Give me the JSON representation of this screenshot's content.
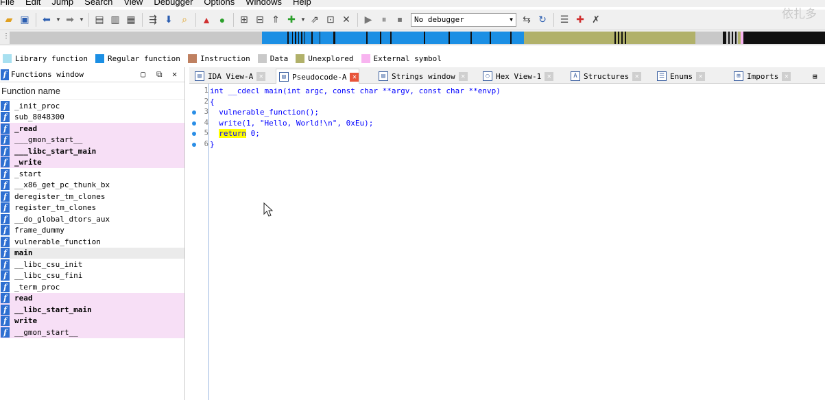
{
  "menu": [
    "File",
    "Edit",
    "Jump",
    "Search",
    "View",
    "Debugger",
    "Options",
    "Windows",
    "Help"
  ],
  "toolbar": {
    "debugger_label": "No debugger"
  },
  "legend": [
    {
      "label": "Library function",
      "color": "#a8e0f0"
    },
    {
      "label": "Regular function",
      "color": "#1b8fe4"
    },
    {
      "label": "Instruction",
      "color": "#bf8060"
    },
    {
      "label": "Data",
      "color": "#c9c9c9"
    },
    {
      "label": "Unexplored",
      "color": "#b1b16a"
    },
    {
      "label": "External symbol",
      "color": "#f8b4f0"
    }
  ],
  "functions_window": {
    "title": "Functions window",
    "column_header": "Function name",
    "items": [
      {
        "name": "_init_proc",
        "style": "normal"
      },
      {
        "name": "sub_8048300",
        "style": "normal"
      },
      {
        "name": "_read",
        "style": "ext"
      },
      {
        "name": "___gmon_start__",
        "style": "ext-normal"
      },
      {
        "name": "___libc_start_main",
        "style": "ext"
      },
      {
        "name": "_write",
        "style": "ext"
      },
      {
        "name": "_start",
        "style": "normal"
      },
      {
        "name": "__x86_get_pc_thunk_bx",
        "style": "normal"
      },
      {
        "name": "deregister_tm_clones",
        "style": "normal"
      },
      {
        "name": "register_tm_clones",
        "style": "normal"
      },
      {
        "name": "__do_global_dtors_aux",
        "style": "normal"
      },
      {
        "name": "frame_dummy",
        "style": "normal"
      },
      {
        "name": "vulnerable_function",
        "style": "normal"
      },
      {
        "name": "main",
        "style": "sel"
      },
      {
        "name": "__libc_csu_init",
        "style": "normal"
      },
      {
        "name": "__libc_csu_fini",
        "style": "normal"
      },
      {
        "name": "_term_proc",
        "style": "normal"
      },
      {
        "name": "read",
        "style": "ext"
      },
      {
        "name": "__libc_start_main",
        "style": "ext"
      },
      {
        "name": "write",
        "style": "ext"
      },
      {
        "name": "__gmon_start__",
        "style": "ext-normal"
      }
    ]
  },
  "tabs": [
    {
      "label": "IDA View-A",
      "active": false
    },
    {
      "label": "Pseudocode-A",
      "active": true
    },
    {
      "label": "Strings window",
      "active": false
    },
    {
      "label": "Hex View-1",
      "active": false
    },
    {
      "label": "Structures",
      "active": false
    },
    {
      "label": "Enums",
      "active": false
    },
    {
      "label": "Imports",
      "active": false
    }
  ],
  "code": [
    {
      "num": "1",
      "text": "int __cdecl main(int argc, const char **argv, const char **envp)",
      "dot": false
    },
    {
      "num": "2",
      "text": "{",
      "dot": false
    },
    {
      "num": "3",
      "text": "  vulnerable_function();",
      "dot": true
    },
    {
      "num": "4",
      "text": "  write(1, \"Hello, World!\\n\", 0xEu);",
      "dot": true
    },
    {
      "num": "5",
      "text": "  return 0;",
      "dot": true,
      "highlight": "return"
    },
    {
      "num": "6",
      "text": "}",
      "dot": true
    }
  ],
  "watermark": "依扎多"
}
